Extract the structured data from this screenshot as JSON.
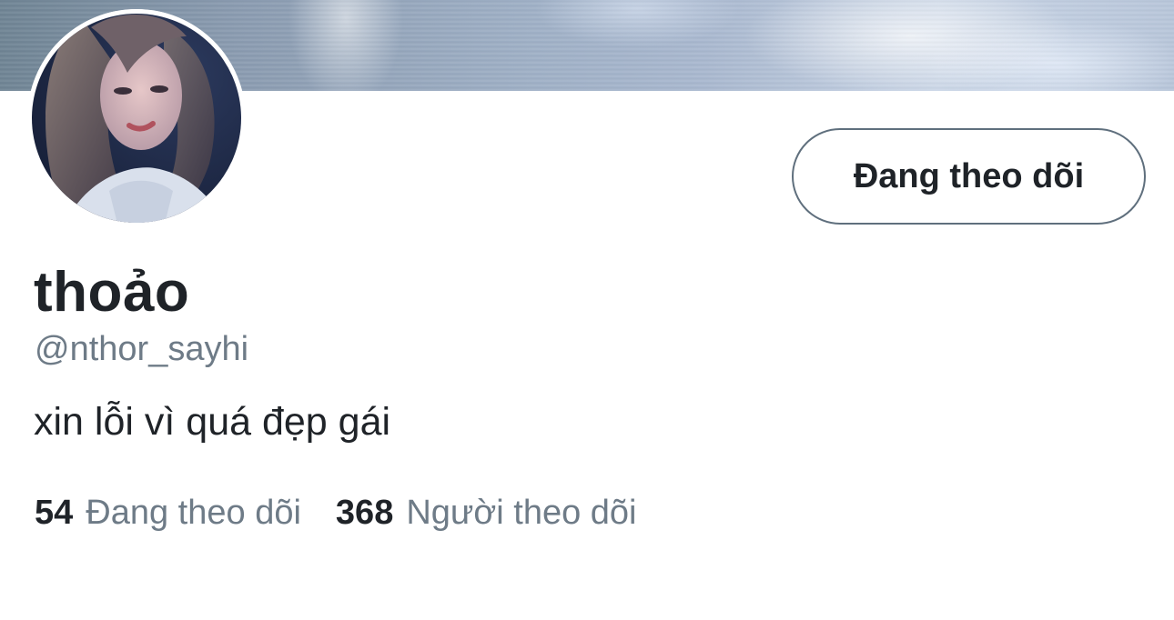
{
  "profile": {
    "display_name": "thoảo",
    "handle": "@nthor_sayhi",
    "bio": "xin lỗi vì quá đẹp gái"
  },
  "actions": {
    "follow_button_label": "Đang theo dõi"
  },
  "stats": {
    "following_count": "54",
    "following_label": "Đang theo dõi",
    "followers_count": "368",
    "followers_label": "Người theo dõi"
  },
  "colors": {
    "text_primary": "#1f2328",
    "text_secondary": "#6e7b87",
    "button_border": "#5f6f7d"
  }
}
